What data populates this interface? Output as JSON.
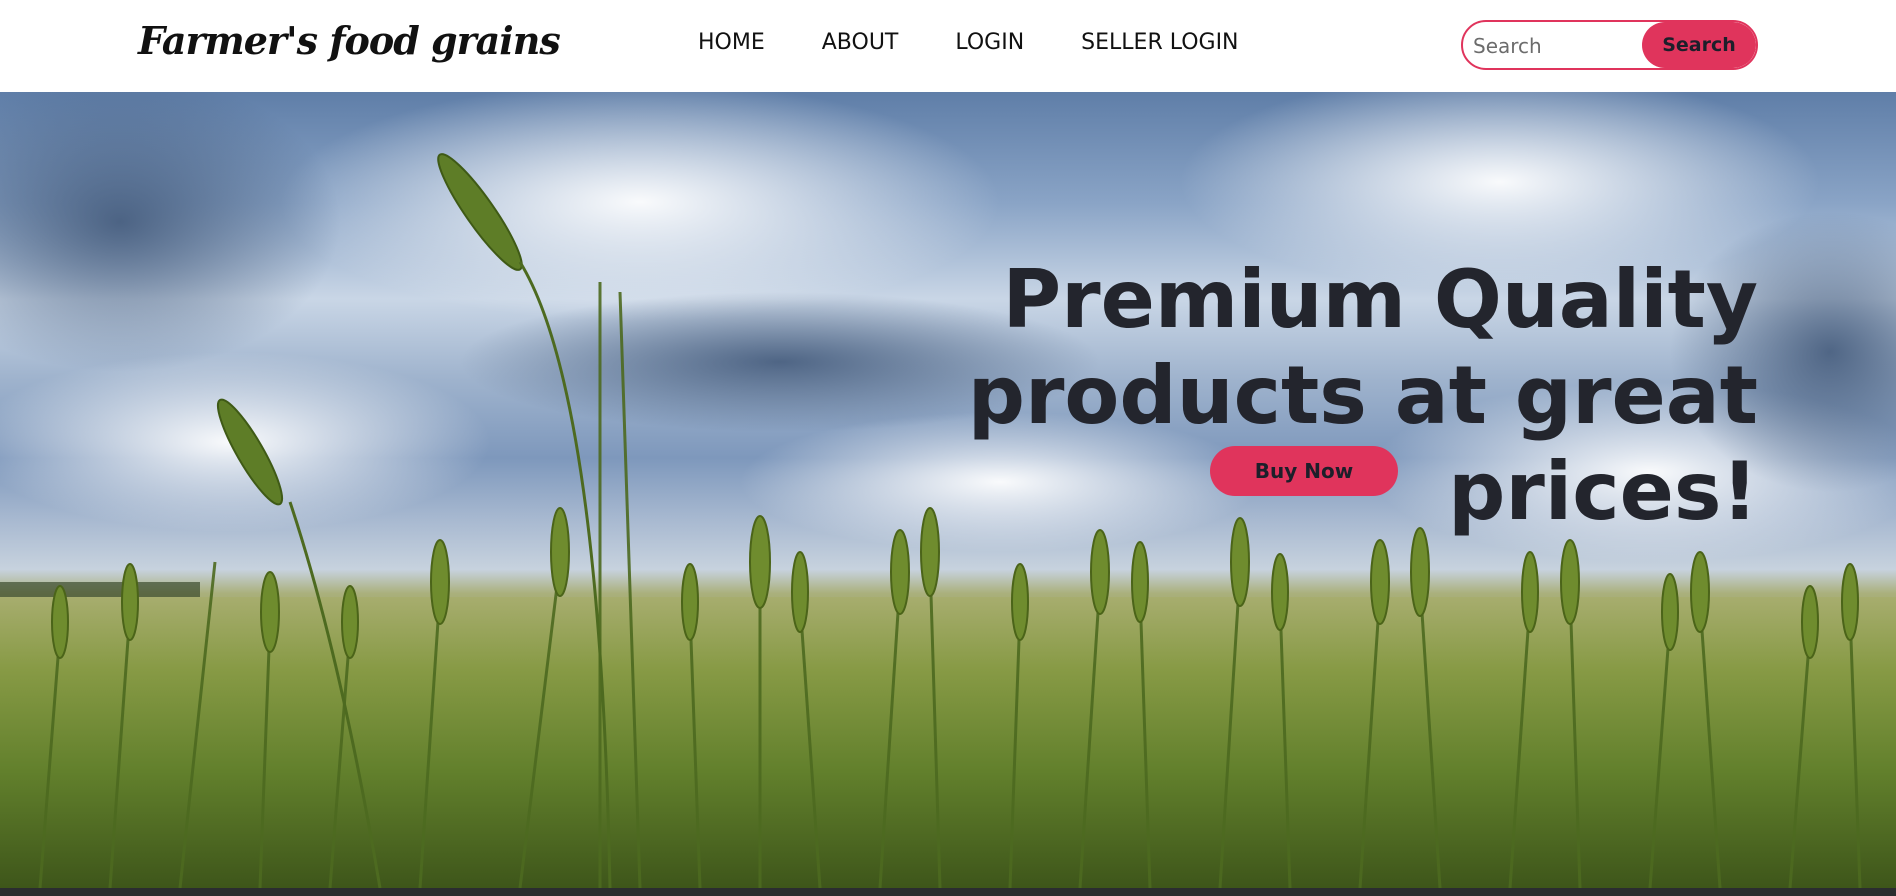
{
  "brand": {
    "name": "Farmer's food grains"
  },
  "nav": {
    "items": [
      {
        "label": "HOME"
      },
      {
        "label": "ABOUT"
      },
      {
        "label": "LOGIN"
      },
      {
        "label": "SELLER LOGIN"
      }
    ]
  },
  "search": {
    "placeholder": "Search",
    "value": "",
    "button_label": "Search"
  },
  "hero": {
    "headline_line1": "Premium Quality",
    "headline_line2": "products at great prices!",
    "cta_label": "Buy Now",
    "image": "wheat-field-under-cloudy-sky"
  },
  "colors": {
    "accent": "#e0345c",
    "headline": "#23252d",
    "nav_text": "#111111",
    "navbar_bg": "#ffffff"
  }
}
